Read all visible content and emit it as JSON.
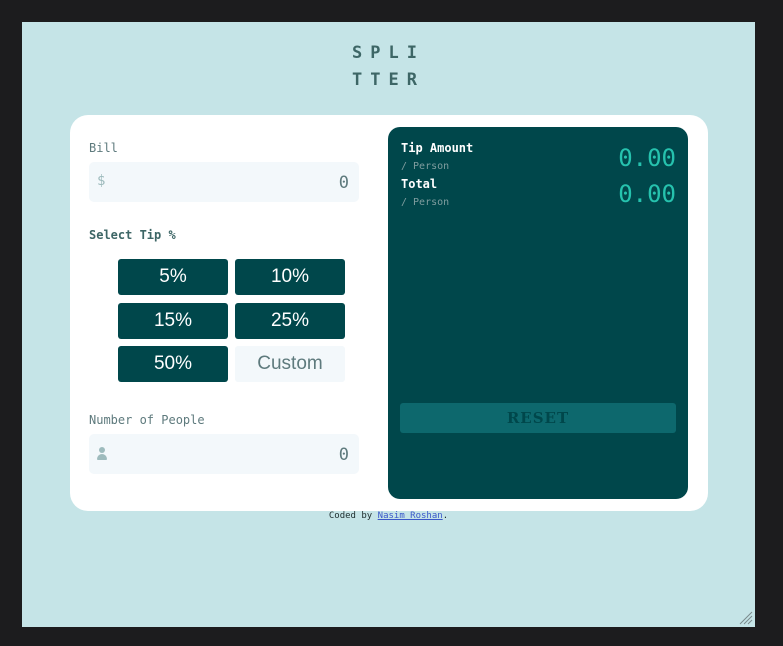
{
  "app": {
    "logo_line1": "SPLI",
    "logo_line2": "TTER"
  },
  "bill": {
    "label": "Bill",
    "prefix": "$",
    "value": "0"
  },
  "tip": {
    "label": "Select Tip %",
    "options": [
      "5%",
      "10%",
      "15%",
      "25%",
      "50%"
    ],
    "custom_placeholder": "Custom"
  },
  "people": {
    "label": "Number of People",
    "value": "0"
  },
  "results": {
    "tip_label": "Tip Amount",
    "tip_sub": "/ Person",
    "tip_value": "0.00",
    "total_label": "Total",
    "total_sub": "/ Person",
    "total_value": "0.00",
    "reset_label": "RESET"
  },
  "credit": {
    "prefix": "Coded by ",
    "author": "Nasim Roshan",
    "suffix": "."
  },
  "colors": {
    "background": "#c5e4e7",
    "dark_cyan": "#00474b",
    "accent": "#26c2ae"
  }
}
